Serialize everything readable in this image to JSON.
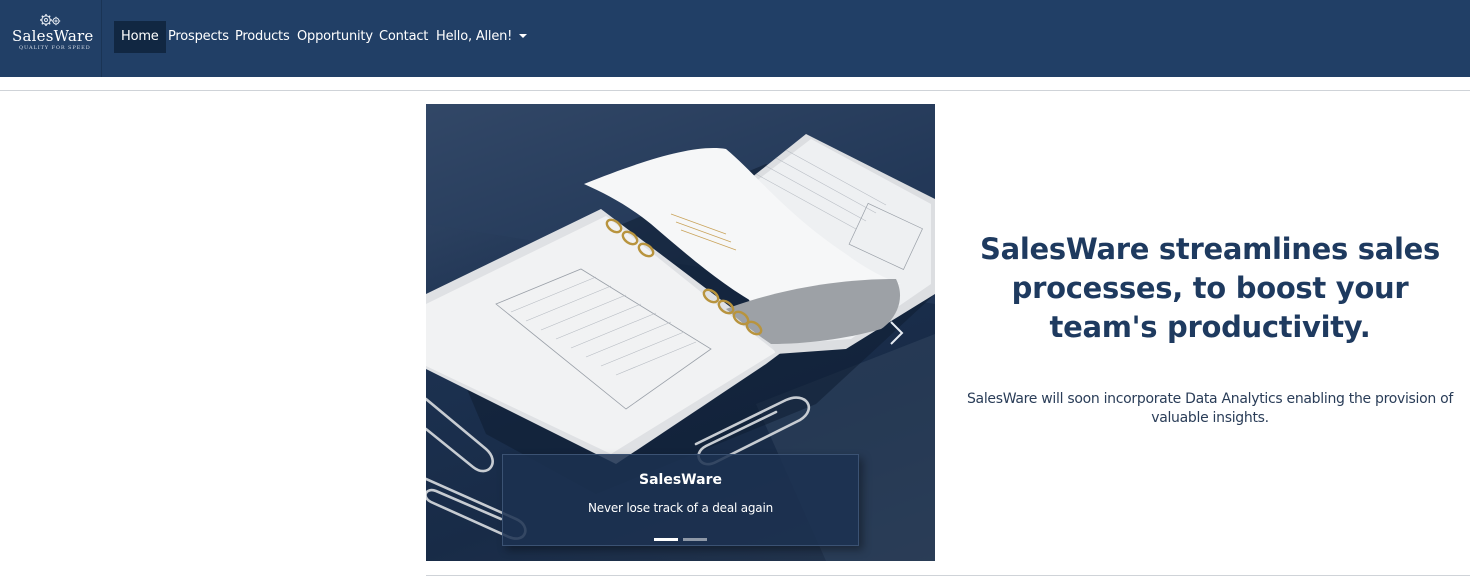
{
  "brand": {
    "name": "SalesWare",
    "tagline": "QUALITY FOR SPEED"
  },
  "nav": {
    "items": [
      {
        "label": "Home",
        "active": true
      },
      {
        "label": "Prospects",
        "active": false
      },
      {
        "label": "Products",
        "active": false
      },
      {
        "label": "Opportunity",
        "active": false
      },
      {
        "label": "Contact",
        "active": false
      }
    ],
    "user_menu": {
      "label": "Hello, Allen!",
      "icon": "caret-down-icon"
    }
  },
  "carousel": {
    "caption_title": "SalesWare",
    "caption_text": "Never lose track of a deal again",
    "slide_count": 2,
    "active_slide": 1,
    "next_icon": "chevron-right-icon"
  },
  "hero": {
    "title": "SalesWare streamlines sales processes, to boost your team's productivity.",
    "subtitle": "SalesWare will soon incorporate Data Analytics enabling the provision of valuable insights."
  },
  "colors": {
    "navbar": "#213f66",
    "nav_active": "#112742",
    "heading": "#1e3a5f"
  }
}
